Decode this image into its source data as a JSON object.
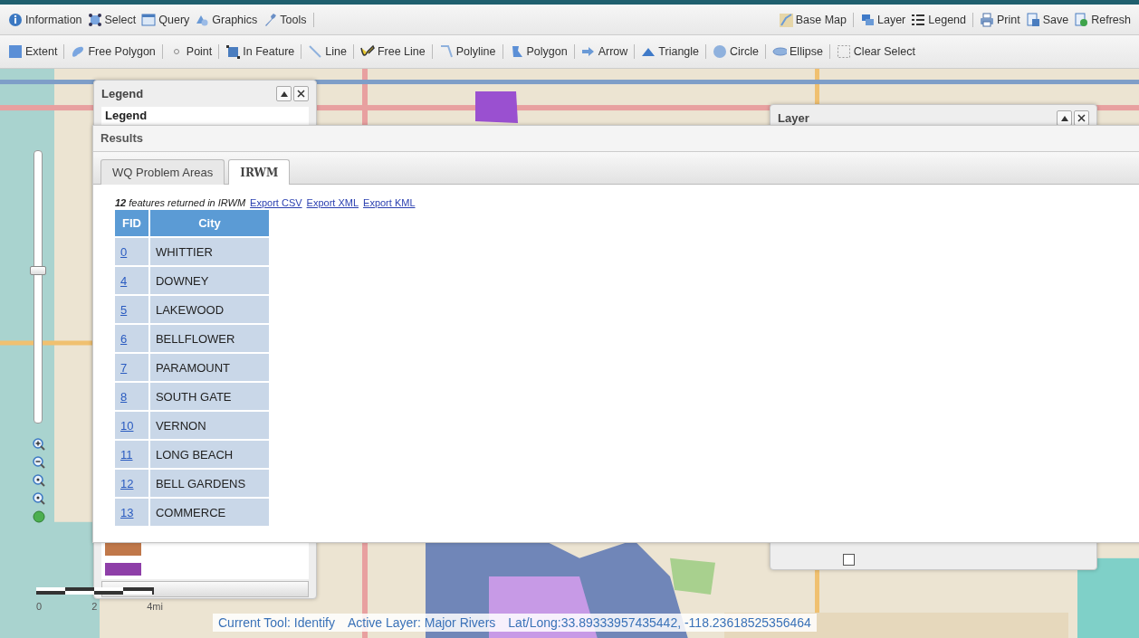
{
  "main_toolbar": {
    "left": [
      {
        "label": "Information"
      },
      {
        "label": "Select"
      },
      {
        "label": "Query"
      },
      {
        "label": "Graphics"
      },
      {
        "label": "Tools"
      }
    ],
    "right": [
      {
        "label": "Base Map"
      },
      {
        "label": "Layer"
      },
      {
        "label": "Legend"
      },
      {
        "label": "Print"
      },
      {
        "label": "Save"
      },
      {
        "label": "Refresh"
      }
    ]
  },
  "draw_toolbar": [
    {
      "label": "Extent"
    },
    {
      "label": "Free Polygon"
    },
    {
      "label": "Point"
    },
    {
      "label": "In Feature"
    },
    {
      "label": "Line"
    },
    {
      "label": "Free Line"
    },
    {
      "label": "Polyline"
    },
    {
      "label": "Polygon"
    },
    {
      "label": "Arrow"
    },
    {
      "label": "Triangle"
    },
    {
      "label": "Circle"
    },
    {
      "label": "Ellipse"
    },
    {
      "label": "Clear Select"
    }
  ],
  "zoom_slider": {
    "level": 0.56
  },
  "legend_panel": {
    "title": "Legend",
    "heading": "Legend",
    "swatches": [
      {
        "color": "#c0784a"
      },
      {
        "color": "#8e3fa8"
      }
    ]
  },
  "layer_panel": {
    "title": "Layer",
    "checkboxes": [
      {
        "checked": false
      }
    ]
  },
  "results_panel": {
    "title": "Results",
    "tabs": [
      {
        "label": "WQ Problem Areas",
        "selected": false
      },
      {
        "label": "IRWM",
        "selected": true
      }
    ],
    "summary": "**12** features returned in IRWM",
    "export_links": [
      "Export CSV",
      "Export XML",
      "Export KML"
    ],
    "table": {
      "columns": [
        "FID",
        "City"
      ],
      "rows": [
        [
          "0",
          "WHITTIER"
        ],
        [
          "4",
          "DOWNEY"
        ],
        [
          "5",
          "LAKEWOOD"
        ],
        [
          "6",
          "BELLFLOWER"
        ],
        [
          "7",
          "PARAMOUNT"
        ],
        [
          "8",
          "SOUTH GATE"
        ],
        [
          "10",
          "VERNON"
        ],
        [
          "11",
          "LONG BEACH"
        ],
        [
          "12",
          "BELL GARDENS"
        ],
        [
          "13",
          "COMMERCE"
        ]
      ]
    }
  },
  "scale_bar": {
    "labels": [
      "0",
      "2",
      "4mi"
    ]
  },
  "status_bar": {
    "items": [
      "Current Tool: Identify",
      "Active Layer: Major Rivers",
      "Lat/Long:33.89333957435442, -118.23618525356464"
    ]
  }
}
